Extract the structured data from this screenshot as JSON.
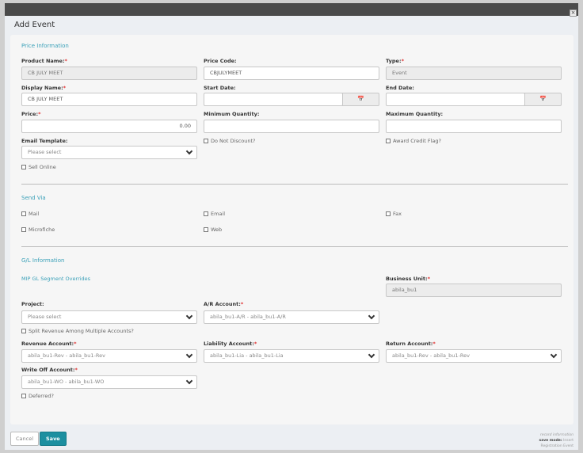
{
  "dialog": {
    "title": "Add Event",
    "close_icon": "×"
  },
  "price_info": {
    "heading": "Price Information",
    "product_name": {
      "label": "Product Name:",
      "value": "CB JULY MEET"
    },
    "price_code": {
      "label": "Price Code:",
      "value": "CBJULYMEET"
    },
    "type": {
      "label": "Type:",
      "value": "Event"
    },
    "display_name": {
      "label": "Display Name:",
      "value": "CB JULY MEET"
    },
    "start_date": {
      "label": "Start Date:",
      "value": ""
    },
    "end_date": {
      "label": "End Date:",
      "value": ""
    },
    "price": {
      "label": "Price:",
      "value": "0.00"
    },
    "min_qty": {
      "label": "Minimum Quantity:",
      "value": ""
    },
    "max_qty": {
      "label": "Maximum Quantity:",
      "value": ""
    },
    "email_template": {
      "label": "Email Template:",
      "value": "Please select"
    },
    "do_not_discount": "Do Not Discount?",
    "award_credit": "Award Credit Flag?",
    "sell_online": "Sell Online",
    "required_mark": "*",
    "calendar_icon": "📅"
  },
  "send_via": {
    "heading": "Send Via",
    "mail": "Mail",
    "email": "Email",
    "fax": "Fax",
    "microfiche": "Microfiche",
    "web": "Web"
  },
  "gl": {
    "heading": "G/L Information",
    "segment_overrides": "MIP GL Segment Overrides",
    "business_unit": {
      "label": "Business Unit:",
      "value": "abila_bu1"
    },
    "project": {
      "label": "Project:",
      "value": "Please select"
    },
    "ar_account": {
      "label": "A/R Account:",
      "value": "abila_bu1-A/R - abila_bu1-A/R"
    },
    "split_revenue": "Split Revenue Among Multiple Accounts?",
    "revenue_account": {
      "label": "Revenue Account:",
      "value": "abila_bu1-Rev - abila_bu1-Rev"
    },
    "liability_account": {
      "label": "Liability Account:",
      "value": "abila_bu1-Lia - abila_bu1-Lia"
    },
    "return_account": {
      "label": "Return Account:",
      "value": "abila_bu1-Rev - abila_bu1-Rev"
    },
    "write_off_account": {
      "label": "Write Off Account:",
      "value": "abila_bu1-WO - abila_bu1-WO"
    },
    "deferred": "Deferred?"
  },
  "footer": {
    "cancel": "Cancel",
    "save": "Save",
    "record_info": "record information",
    "save_mode_label": "save mode:",
    "save_mode": "Insert",
    "record_type": "Registration Event"
  }
}
